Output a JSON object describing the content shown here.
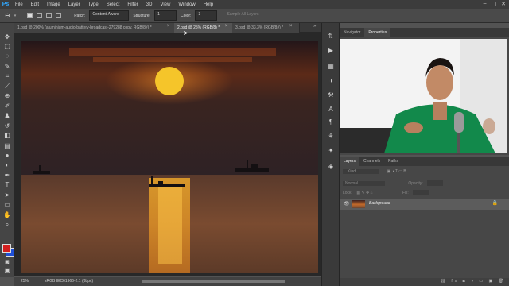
{
  "menubar": {
    "logo": "Ps",
    "items": [
      "File",
      "Edit",
      "Image",
      "Layer",
      "Type",
      "Select",
      "Filter",
      "3D",
      "View",
      "Window",
      "Help"
    ],
    "controls": [
      "–",
      "▢",
      "✕"
    ]
  },
  "options": {
    "patch_label": "Patch:",
    "patch_value": "Content-Aware",
    "structure_label": "Structure:",
    "structure_value": "1",
    "color_label": "Color:",
    "color_value": "3",
    "sample_all": "Sample All Layers"
  },
  "tabs": [
    {
      "label": "1.psd @ 200% (aluminium-audio-battery-broadcast-279288 copy, RGB/8#) *",
      "close": "×"
    },
    {
      "label": "2.psd @ 25% (RGB/8) *",
      "close": "×"
    },
    {
      "label": "3.psd @ 33.3% (RGB/8#) *",
      "close": "×"
    }
  ],
  "status": {
    "zoom": "25%",
    "profile": "sRGB IEC61966-2.1 (8bpc)"
  },
  "panels": {
    "top_tabs": [
      "Navigator",
      "Properties"
    ],
    "layers_tabs": [
      "Layers",
      "Channels",
      "Paths"
    ],
    "kind_placeholder": "Kind",
    "blend_mode": "Normal",
    "opacity_label": "Opacity:",
    "lock_label": "Lock:",
    "fill_label": "Fill:",
    "layer_name": "Background"
  },
  "colors": {
    "accent": "#31a8ff",
    "sky_top": "#2b1a1e",
    "sun": "#f5c52a",
    "water": "#6a4632",
    "foreground_swatch": "#d21e1e",
    "background_swatch": "#1e4fd6"
  },
  "icons": [
    "move-icon",
    "marquee-icon",
    "lasso-icon",
    "quick-select-icon",
    "crop-icon",
    "eyedropper-icon",
    "patch-icon",
    "brush-icon",
    "stamp-icon",
    "history-brush-icon",
    "eraser-icon",
    "gradient-icon",
    "blur-icon",
    "dodge-icon",
    "pen-icon",
    "type-icon",
    "path-select-icon",
    "shape-icon",
    "hand-icon",
    "zoom-icon"
  ]
}
